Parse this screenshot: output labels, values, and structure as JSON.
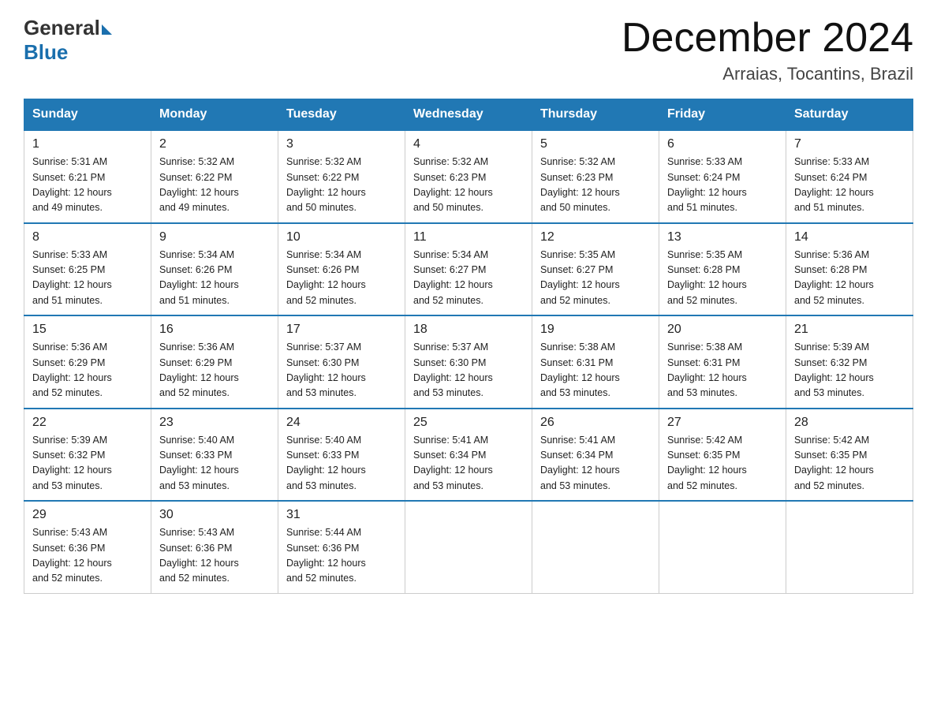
{
  "header": {
    "logo_general": "General",
    "logo_blue": "Blue",
    "month_title": "December 2024",
    "location": "Arraias, Tocantins, Brazil"
  },
  "days_of_week": [
    "Sunday",
    "Monday",
    "Tuesday",
    "Wednesday",
    "Thursday",
    "Friday",
    "Saturday"
  ],
  "weeks": [
    [
      {
        "day": 1,
        "sunrise": "5:31 AM",
        "sunset": "6:21 PM",
        "daylight": "12 hours and 49 minutes."
      },
      {
        "day": 2,
        "sunrise": "5:32 AM",
        "sunset": "6:22 PM",
        "daylight": "12 hours and 49 minutes."
      },
      {
        "day": 3,
        "sunrise": "5:32 AM",
        "sunset": "6:22 PM",
        "daylight": "12 hours and 50 minutes."
      },
      {
        "day": 4,
        "sunrise": "5:32 AM",
        "sunset": "6:23 PM",
        "daylight": "12 hours and 50 minutes."
      },
      {
        "day": 5,
        "sunrise": "5:32 AM",
        "sunset": "6:23 PM",
        "daylight": "12 hours and 50 minutes."
      },
      {
        "day": 6,
        "sunrise": "5:33 AM",
        "sunset": "6:24 PM",
        "daylight": "12 hours and 51 minutes."
      },
      {
        "day": 7,
        "sunrise": "5:33 AM",
        "sunset": "6:24 PM",
        "daylight": "12 hours and 51 minutes."
      }
    ],
    [
      {
        "day": 8,
        "sunrise": "5:33 AM",
        "sunset": "6:25 PM",
        "daylight": "12 hours and 51 minutes."
      },
      {
        "day": 9,
        "sunrise": "5:34 AM",
        "sunset": "6:26 PM",
        "daylight": "12 hours and 51 minutes."
      },
      {
        "day": 10,
        "sunrise": "5:34 AM",
        "sunset": "6:26 PM",
        "daylight": "12 hours and 52 minutes."
      },
      {
        "day": 11,
        "sunrise": "5:34 AM",
        "sunset": "6:27 PM",
        "daylight": "12 hours and 52 minutes."
      },
      {
        "day": 12,
        "sunrise": "5:35 AM",
        "sunset": "6:27 PM",
        "daylight": "12 hours and 52 minutes."
      },
      {
        "day": 13,
        "sunrise": "5:35 AM",
        "sunset": "6:28 PM",
        "daylight": "12 hours and 52 minutes."
      },
      {
        "day": 14,
        "sunrise": "5:36 AM",
        "sunset": "6:28 PM",
        "daylight": "12 hours and 52 minutes."
      }
    ],
    [
      {
        "day": 15,
        "sunrise": "5:36 AM",
        "sunset": "6:29 PM",
        "daylight": "12 hours and 52 minutes."
      },
      {
        "day": 16,
        "sunrise": "5:36 AM",
        "sunset": "6:29 PM",
        "daylight": "12 hours and 52 minutes."
      },
      {
        "day": 17,
        "sunrise": "5:37 AM",
        "sunset": "6:30 PM",
        "daylight": "12 hours and 53 minutes."
      },
      {
        "day": 18,
        "sunrise": "5:37 AM",
        "sunset": "6:30 PM",
        "daylight": "12 hours and 53 minutes."
      },
      {
        "day": 19,
        "sunrise": "5:38 AM",
        "sunset": "6:31 PM",
        "daylight": "12 hours and 53 minutes."
      },
      {
        "day": 20,
        "sunrise": "5:38 AM",
        "sunset": "6:31 PM",
        "daylight": "12 hours and 53 minutes."
      },
      {
        "day": 21,
        "sunrise": "5:39 AM",
        "sunset": "6:32 PM",
        "daylight": "12 hours and 53 minutes."
      }
    ],
    [
      {
        "day": 22,
        "sunrise": "5:39 AM",
        "sunset": "6:32 PM",
        "daylight": "12 hours and 53 minutes."
      },
      {
        "day": 23,
        "sunrise": "5:40 AM",
        "sunset": "6:33 PM",
        "daylight": "12 hours and 53 minutes."
      },
      {
        "day": 24,
        "sunrise": "5:40 AM",
        "sunset": "6:33 PM",
        "daylight": "12 hours and 53 minutes."
      },
      {
        "day": 25,
        "sunrise": "5:41 AM",
        "sunset": "6:34 PM",
        "daylight": "12 hours and 53 minutes."
      },
      {
        "day": 26,
        "sunrise": "5:41 AM",
        "sunset": "6:34 PM",
        "daylight": "12 hours and 53 minutes."
      },
      {
        "day": 27,
        "sunrise": "5:42 AM",
        "sunset": "6:35 PM",
        "daylight": "12 hours and 52 minutes."
      },
      {
        "day": 28,
        "sunrise": "5:42 AM",
        "sunset": "6:35 PM",
        "daylight": "12 hours and 52 minutes."
      }
    ],
    [
      {
        "day": 29,
        "sunrise": "5:43 AM",
        "sunset": "6:36 PM",
        "daylight": "12 hours and 52 minutes."
      },
      {
        "day": 30,
        "sunrise": "5:43 AM",
        "sunset": "6:36 PM",
        "daylight": "12 hours and 52 minutes."
      },
      {
        "day": 31,
        "sunrise": "5:44 AM",
        "sunset": "6:36 PM",
        "daylight": "12 hours and 52 minutes."
      },
      null,
      null,
      null,
      null
    ]
  ]
}
